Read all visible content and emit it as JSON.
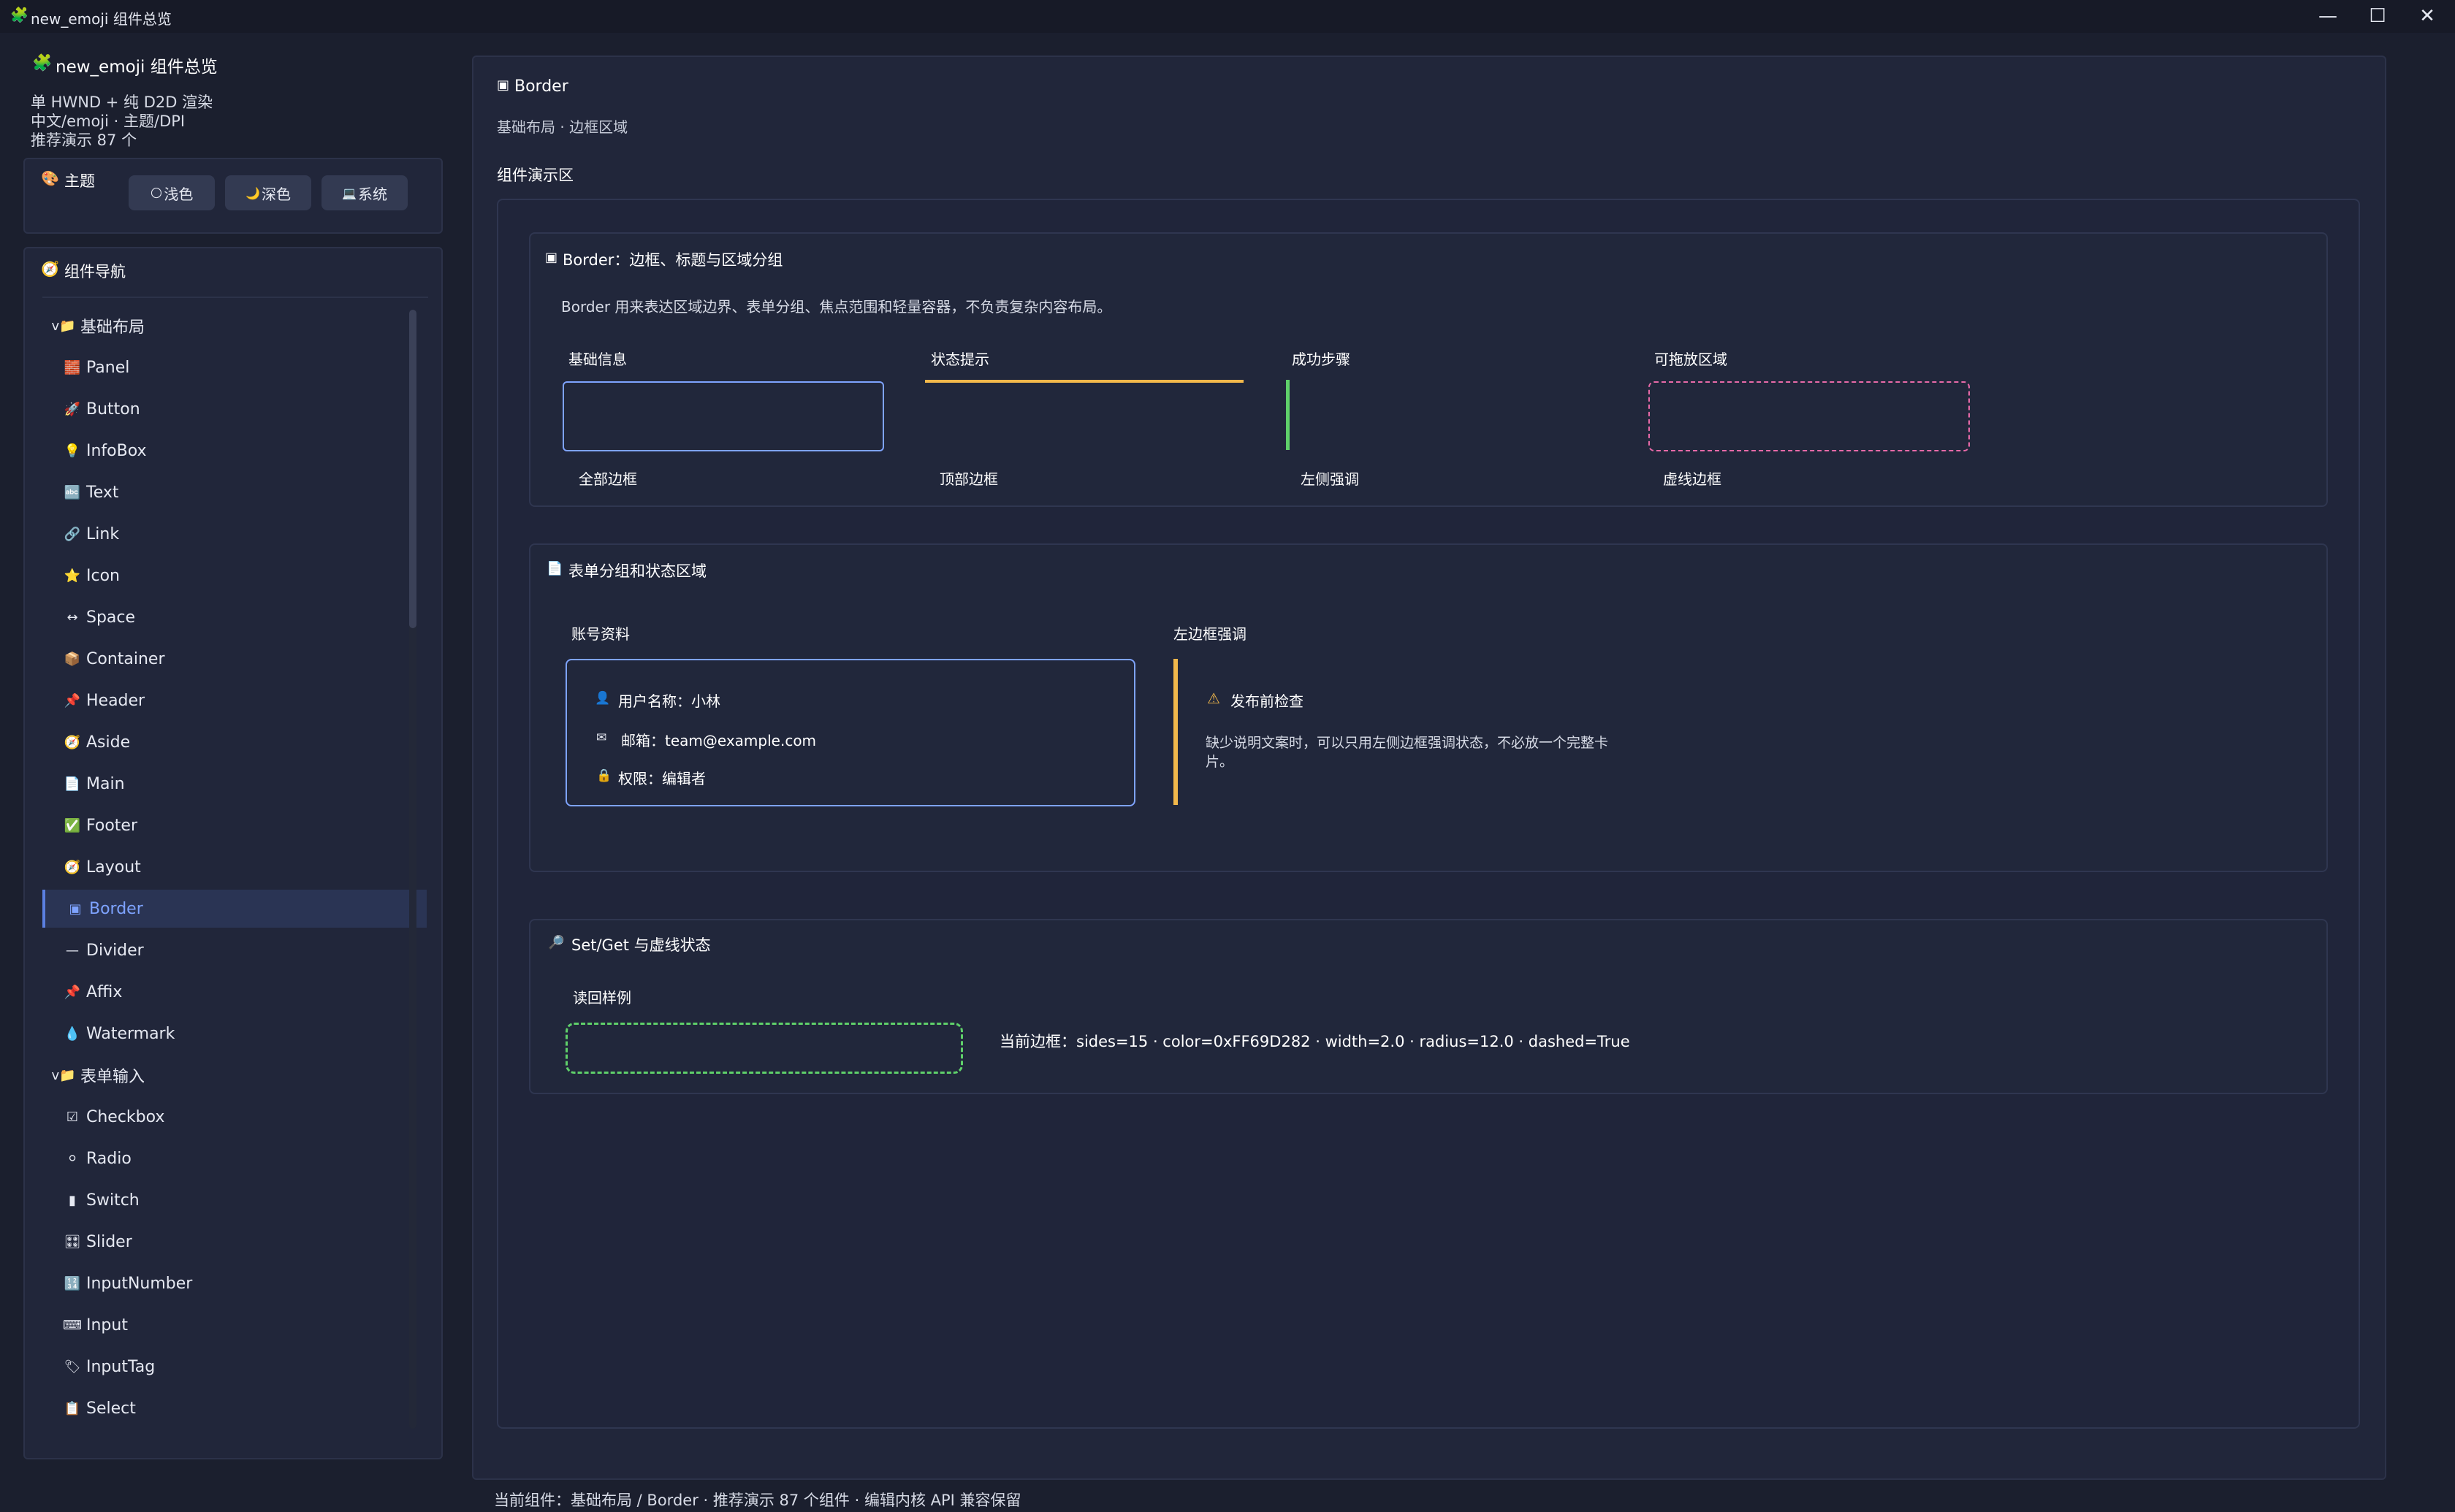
{
  "window": {
    "icon": "🧩",
    "title": "new_emoji 组件总览",
    "controls": {
      "minimize": "—",
      "maximize": "☐",
      "close": "✕"
    }
  },
  "sidebar": {
    "brand_icon": "🧩",
    "brand": "new_emoji 组件总览",
    "info": [
      "单 HWND + 纯 D2D 渲染",
      "中文/emoji · 主题/DPI",
      "推荐演示 87 个"
    ],
    "theme": {
      "icon": "🎨",
      "title": "主题",
      "buttons": [
        {
          "icon": "🌕",
          "label": "浅色"
        },
        {
          "icon": "🌙",
          "label": "深色"
        },
        {
          "icon": "💻",
          "label": "系统"
        }
      ]
    },
    "nav": {
      "icon": "🧭",
      "title": "组件导航",
      "items": [
        {
          "icon": "v📁",
          "label": "基础布局",
          "group": true
        },
        {
          "icon": "🧱",
          "label": "Panel"
        },
        {
          "icon": "🚀",
          "label": "Button"
        },
        {
          "icon": "💡",
          "label": "InfoBox"
        },
        {
          "icon": "🔤",
          "label": "Text"
        },
        {
          "icon": "🔗",
          "label": "Link"
        },
        {
          "icon": "⭐",
          "label": "Icon"
        },
        {
          "icon": "↔",
          "label": "Space"
        },
        {
          "icon": "📦",
          "label": "Container"
        },
        {
          "icon": "📌",
          "label": "Header"
        },
        {
          "icon": "🧭",
          "label": "Aside"
        },
        {
          "icon": "📄",
          "label": "Main"
        },
        {
          "icon": "✅",
          "label": "Footer"
        },
        {
          "icon": "🧭",
          "label": "Layout"
        },
        {
          "icon": "▣",
          "label": "Border",
          "active": true
        },
        {
          "icon": "—",
          "label": "Divider"
        },
        {
          "icon": "📌",
          "label": "Affix"
        },
        {
          "icon": "💧",
          "label": "Watermark"
        },
        {
          "icon": "v📁",
          "label": "表单输入",
          "group": true
        },
        {
          "icon": "☑",
          "label": "Checkbox"
        },
        {
          "icon": "⚪",
          "label": "Radio"
        },
        {
          "icon": "▮",
          "label": "Switch"
        },
        {
          "icon": "🎛",
          "label": "Slider"
        },
        {
          "icon": "🔢",
          "label": "InputNumber"
        },
        {
          "icon": "⌨",
          "label": "Input"
        },
        {
          "icon": "🏷",
          "label": "InputTag"
        },
        {
          "icon": "📋",
          "label": "Select"
        }
      ]
    }
  },
  "main": {
    "title_icon": "▣",
    "title": "Border",
    "breadcrumb": "基础布局 · 边框区域",
    "demo_label": "组件演示区",
    "section1": {
      "icon": "▣",
      "title": "Border：边框、标题与区域分组",
      "desc": "Border 用来表达区域边界、表单分组、焦点范围和轻量容器，不负责复杂内容布局。",
      "samples": [
        {
          "title": "基础信息",
          "caption": "全部边框"
        },
        {
          "title": "状态提示",
          "caption": "顶部边框"
        },
        {
          "title": "成功步骤",
          "caption": "左侧强调"
        },
        {
          "title": "可拖放区域",
          "caption": "虚线边框"
        }
      ]
    },
    "section2": {
      "icon": "📄",
      "title": "表单分组和状态区域",
      "account": {
        "label": "账号资料",
        "rows": [
          {
            "icon": "👤",
            "text": "用户名称：小林"
          },
          {
            "icon": "✉",
            "text": "邮箱：team@example.com"
          },
          {
            "icon": "🔒",
            "text": "权限：编辑者"
          }
        ]
      },
      "emphasis": {
        "label": "左边框强调",
        "warn_icon": "⚠",
        "warn_title": "发布前检查",
        "warn_text_1": "缺少说明文案时，可以只用左侧边框强调状态，不必放一个完整卡",
        "warn_text_2": "片。"
      }
    },
    "section3": {
      "icon": "🔎",
      "title": "Set/Get 与虚线状态",
      "readback_label": "读回样例",
      "current": "当前边框：sides=15 · color=0xFF69D282 · width=2.0 · radius=12.0 · dashed=True"
    }
  },
  "status_bar": "当前组件：基础布局 / Border · 推荐演示 87 个组件 · 编辑内核 API 兼容保留",
  "colors": {
    "background": "#1b1f2e",
    "accent_blue": "#7ea3ff",
    "accent_yellow": "#f2b84b",
    "accent_green": "#5fd06a",
    "accent_pink": "#e86aa8"
  }
}
